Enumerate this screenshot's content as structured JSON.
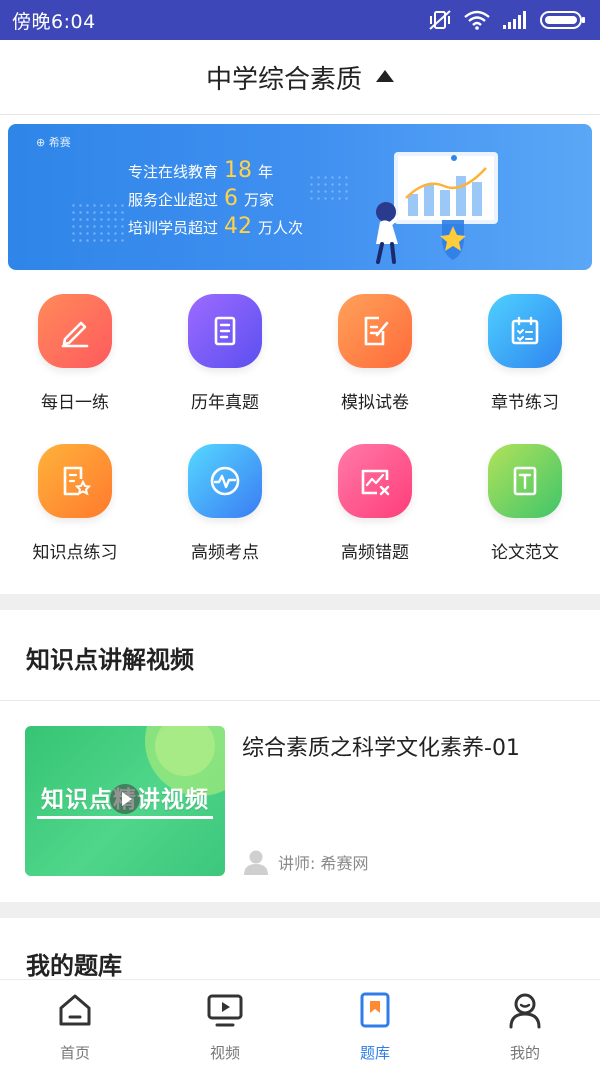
{
  "status_bar": {
    "time": "傍晚6:04"
  },
  "header": {
    "title": "中学综合素质"
  },
  "banner": {
    "brand": "希赛",
    "lines": [
      {
        "prefix": "专注在线教育",
        "number": "18",
        "suffix": "年"
      },
      {
        "prefix": "服务企业超过",
        "number": "6",
        "suffix": "万家"
      },
      {
        "prefix": "培训学员超过",
        "number": "42",
        "suffix": "万人次"
      }
    ]
  },
  "grid": {
    "items": [
      {
        "label": "每日一练",
        "icon": "pencil-icon",
        "color": "#ff6a55"
      },
      {
        "label": "历年真题",
        "icon": "document-icon",
        "color": "#7a5cf5"
      },
      {
        "label": "模拟试卷",
        "icon": "edit-paper-icon",
        "color": "#ff8540"
      },
      {
        "label": "章节练习",
        "icon": "calendar-checklist-icon",
        "color": "#36a8f5"
      },
      {
        "label": "知识点练习",
        "icon": "star-document-icon",
        "color": "#ff8a35"
      },
      {
        "label": "高频考点",
        "icon": "pulse-icon",
        "color": "#3d8ef7"
      },
      {
        "label": "高频错题",
        "icon": "chart-error-icon",
        "color": "#ff4d8a"
      },
      {
        "label": "论文范文",
        "icon": "text-document-icon",
        "color": "#7fcf46"
      }
    ]
  },
  "video_section": {
    "title": "知识点讲解视频",
    "video": {
      "thumbnail_text": "知识点精讲视频",
      "title": "综合素质之科学文化素养-01",
      "teacher": "讲师: 希赛网"
    }
  },
  "bank_section": {
    "title": "我的题库"
  },
  "tabbar": {
    "active": "题库",
    "accent": "#2f7ee8",
    "tabs": [
      {
        "label": "首页",
        "icon": "home-icon"
      },
      {
        "label": "视频",
        "icon": "video-play-icon"
      },
      {
        "label": "题库",
        "icon": "bookmark-book-icon"
      },
      {
        "label": "我的",
        "icon": "user-icon"
      }
    ]
  }
}
